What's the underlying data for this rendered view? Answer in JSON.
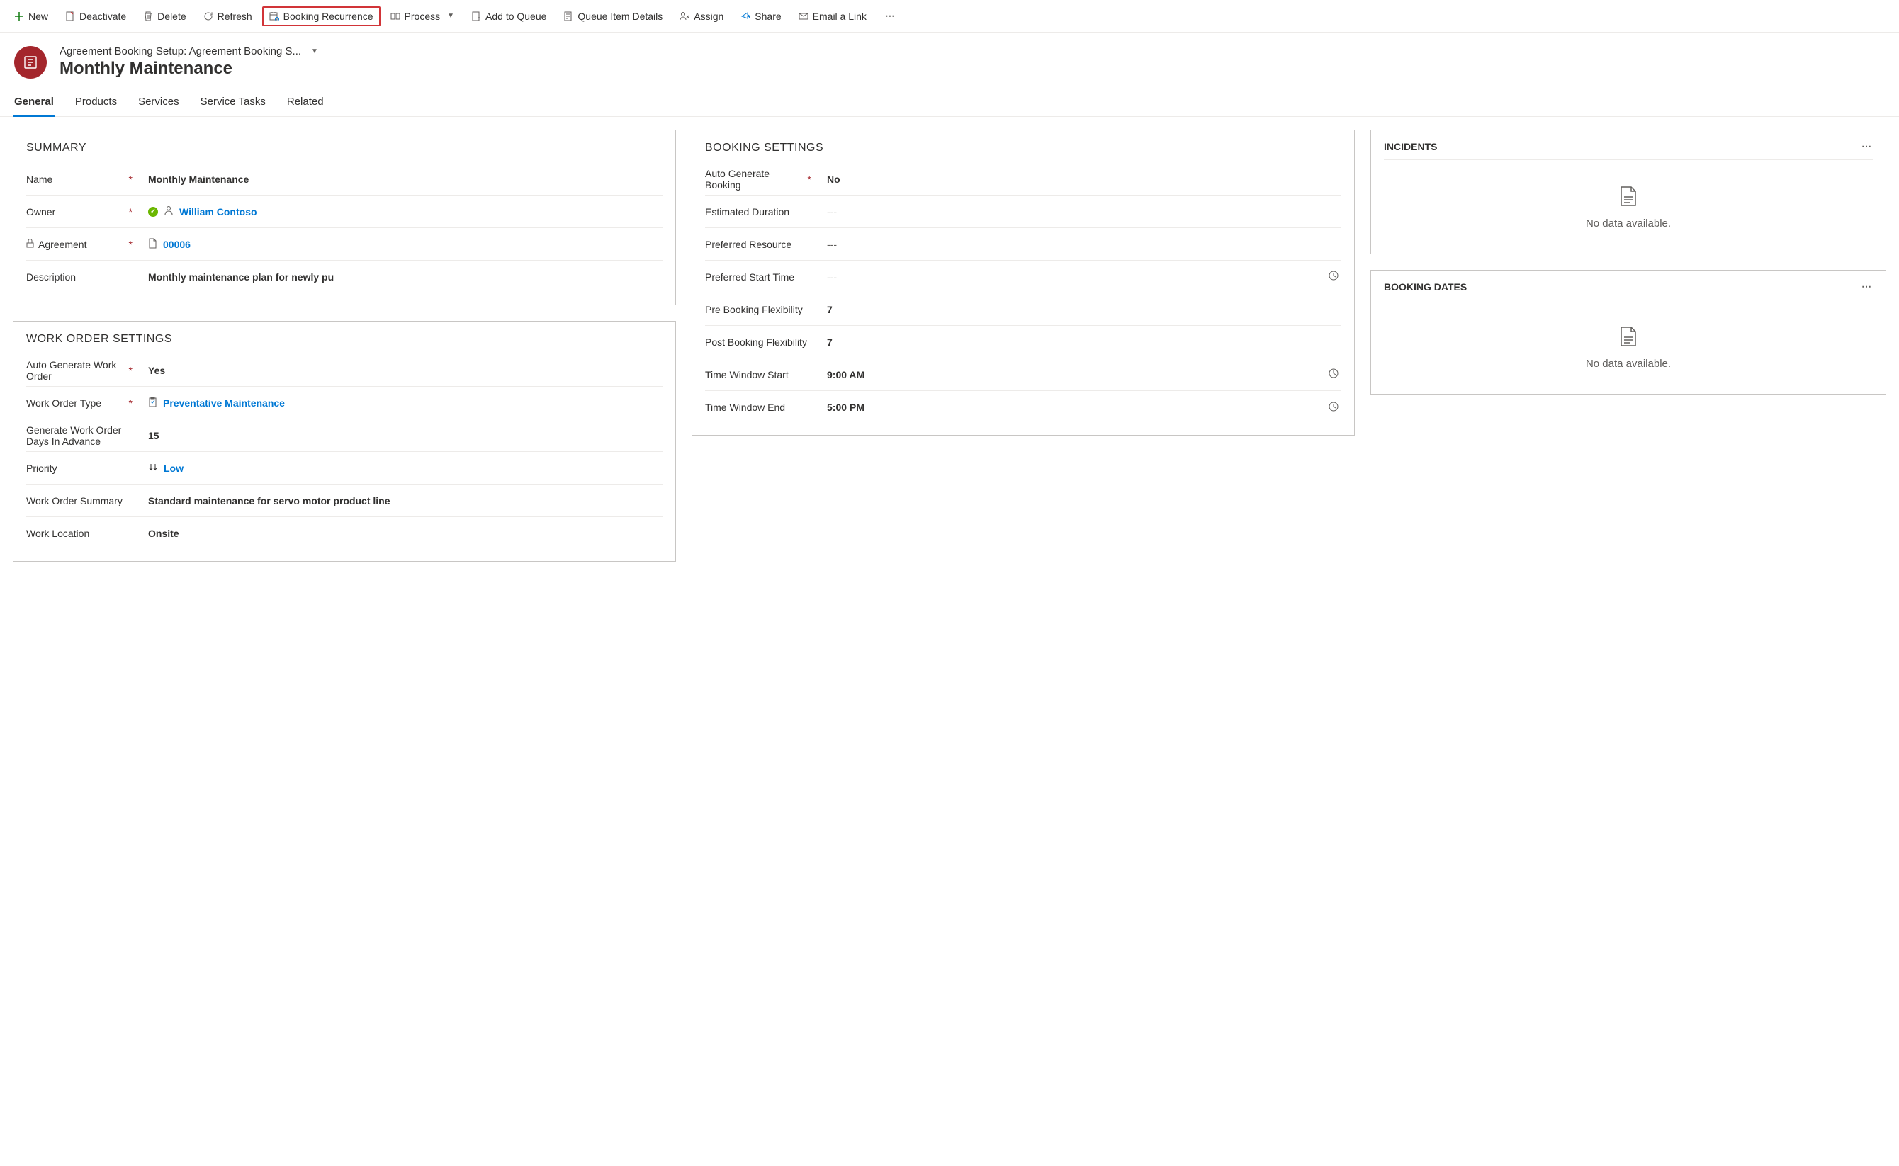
{
  "commandBar": {
    "new": "New",
    "deactivate": "Deactivate",
    "delete": "Delete",
    "refresh": "Refresh",
    "bookingRecurrence": "Booking Recurrence",
    "process": "Process",
    "addToQueue": "Add to Queue",
    "queueItemDetails": "Queue Item Details",
    "assign": "Assign",
    "share": "Share",
    "emailLink": "Email a Link"
  },
  "header": {
    "breadcrumb": "Agreement Booking Setup: Agreement Booking S...",
    "title": "Monthly Maintenance"
  },
  "tabs": {
    "general": "General",
    "products": "Products",
    "services": "Services",
    "serviceTasks": "Service Tasks",
    "related": "Related"
  },
  "summary": {
    "title": "SUMMARY",
    "name": {
      "label": "Name",
      "value": "Monthly Maintenance"
    },
    "owner": {
      "label": "Owner",
      "value": "William Contoso"
    },
    "agreement": {
      "label": "Agreement",
      "value": "00006"
    },
    "description": {
      "label": "Description",
      "value": "Monthly maintenance plan for newly pu"
    }
  },
  "workOrderSettings": {
    "title": "WORK ORDER SETTINGS",
    "autoGenerate": {
      "label": "Auto Generate Work Order",
      "value": "Yes"
    },
    "woType": {
      "label": "Work Order Type",
      "value": "Preventative Maintenance"
    },
    "daysAdvance": {
      "label": "Generate Work Order Days In Advance",
      "value": "15"
    },
    "priority": {
      "label": "Priority",
      "value": "Low"
    },
    "summaryField": {
      "label": "Work Order Summary",
      "value": "Standard maintenance for servo motor product line"
    },
    "location": {
      "label": "Work Location",
      "value": "Onsite"
    }
  },
  "bookingSettings": {
    "title": "BOOKING SETTINGS",
    "autoGenerate": {
      "label": "Auto Generate Booking",
      "value": "No"
    },
    "estDuration": {
      "label": "Estimated Duration",
      "value": "---"
    },
    "prefResource": {
      "label": "Preferred Resource",
      "value": "---"
    },
    "prefStart": {
      "label": "Preferred Start Time",
      "value": "---"
    },
    "preFlex": {
      "label": "Pre Booking Flexibility",
      "value": "7"
    },
    "postFlex": {
      "label": "Post Booking Flexibility",
      "value": "7"
    },
    "winStart": {
      "label": "Time Window Start",
      "value": "9:00 AM"
    },
    "winEnd": {
      "label": "Time Window End",
      "value": "5:00 PM"
    }
  },
  "sidePanels": {
    "incidents": {
      "title": "INCIDENTS",
      "noData": "No data available."
    },
    "bookingDates": {
      "title": "BOOKING DATES",
      "noData": "No data available."
    }
  }
}
